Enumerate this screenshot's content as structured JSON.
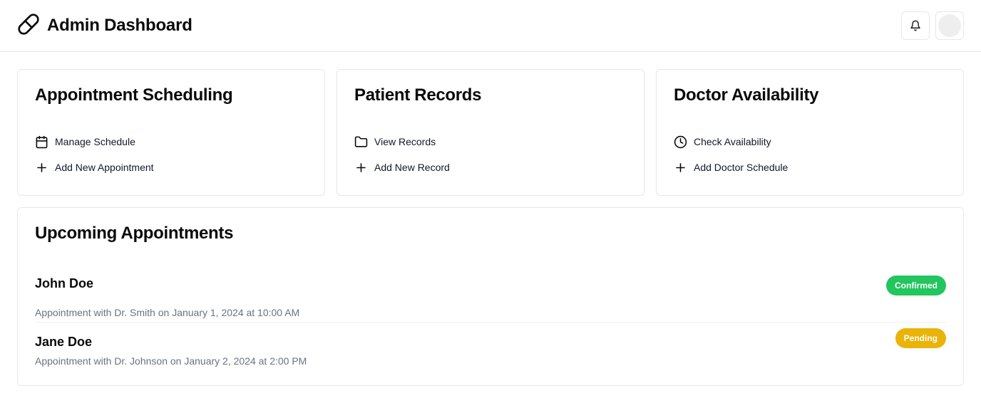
{
  "header": {
    "title": "Admin Dashboard",
    "logo_icon": "pill-icon",
    "notification_icon": "bell-icon"
  },
  "cards": [
    {
      "title": "Appointment Scheduling",
      "actions": [
        {
          "icon": "calendar-icon",
          "label": "Manage Schedule"
        },
        {
          "icon": "plus-icon",
          "label": "Add New Appointment"
        }
      ]
    },
    {
      "title": "Patient Records",
      "actions": [
        {
          "icon": "folder-icon",
          "label": "View Records"
        },
        {
          "icon": "plus-icon",
          "label": "Add New Record"
        }
      ]
    },
    {
      "title": "Doctor Availability",
      "actions": [
        {
          "icon": "clock-icon",
          "label": "Check Availability"
        },
        {
          "icon": "plus-icon",
          "label": "Add Doctor Schedule"
        }
      ]
    }
  ],
  "appointments": {
    "title": "Upcoming Appointments",
    "items": [
      {
        "name": "John Doe",
        "description": "Appointment with Dr. Smith on January 1, 2024 at 10:00 AM",
        "status": "Confirmed",
        "status_color": "#22c55e"
      },
      {
        "name": "Jane Doe",
        "description": "Appointment with Dr. Johnson on January 2, 2024 at 2:00 PM",
        "status": "Pending",
        "status_color": "#eab308"
      }
    ]
  }
}
